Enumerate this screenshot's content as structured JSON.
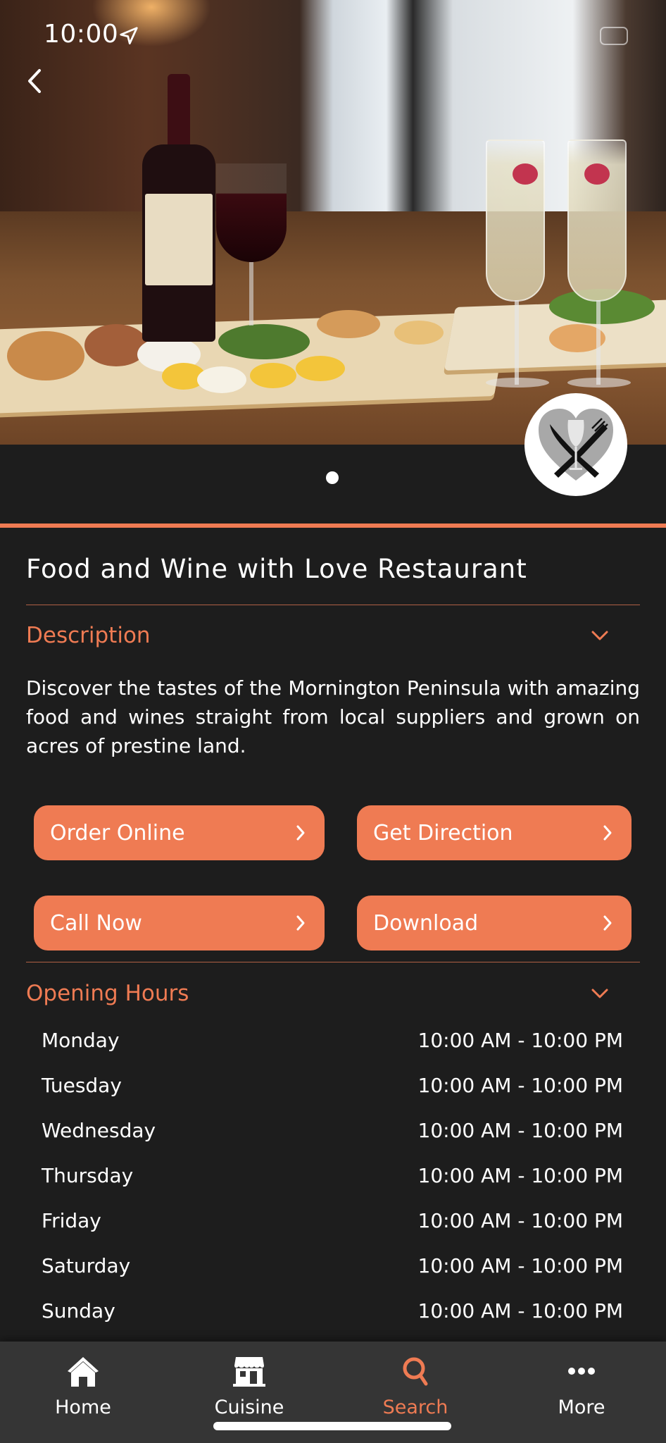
{
  "status_bar": {
    "time": "10:00",
    "location_icon": "location-arrow-icon",
    "battery_icon": "battery-icon"
  },
  "navigation": {
    "back_icon": "chevron-left-icon"
  },
  "hero": {
    "image_description": "Restaurant table with wine bottle, red wine glass, champagne flutes and appetizer boards",
    "logo_icon": "heart-cutlery-wine-logo",
    "carousel_pages": 1,
    "carousel_active_page": 1
  },
  "colors": {
    "accent": "#ef7b53",
    "background": "#1d1d1d",
    "tabbar": "#353535",
    "text": "#ffffff"
  },
  "restaurant": {
    "name": "Food and Wine with Love Restaurant"
  },
  "description": {
    "heading": "Description",
    "text": "Discover the tastes of the Mornington Peninsula with amazing food and wines straight from local suppliers and grown on acres of prestine land."
  },
  "actions": [
    {
      "label": "Order Online"
    },
    {
      "label": "Get Direction"
    },
    {
      "label": "Call Now"
    },
    {
      "label": "Download"
    }
  ],
  "opening_hours": {
    "heading": "Opening Hours",
    "rows": [
      {
        "day": "Monday",
        "hours": "10:00 AM - 10:00 PM"
      },
      {
        "day": "Tuesday",
        "hours": "10:00 AM - 10:00 PM"
      },
      {
        "day": "Wednesday",
        "hours": "10:00 AM - 10:00 PM"
      },
      {
        "day": "Thursday",
        "hours": "10:00 AM - 10:00 PM"
      },
      {
        "day": "Friday",
        "hours": "10:00 AM - 10:00 PM"
      },
      {
        "day": "Saturday",
        "hours": "10:00 AM - 10:00 PM"
      },
      {
        "day": "Sunday",
        "hours": "10:00 AM - 10:00 PM"
      }
    ]
  },
  "tabbar": {
    "active": "Search",
    "items": [
      {
        "label": "Home",
        "icon": "home-icon"
      },
      {
        "label": "Cuisine",
        "icon": "storefront-icon"
      },
      {
        "label": "Search",
        "icon": "search-icon"
      },
      {
        "label": "More",
        "icon": "more-dots-icon"
      }
    ]
  }
}
